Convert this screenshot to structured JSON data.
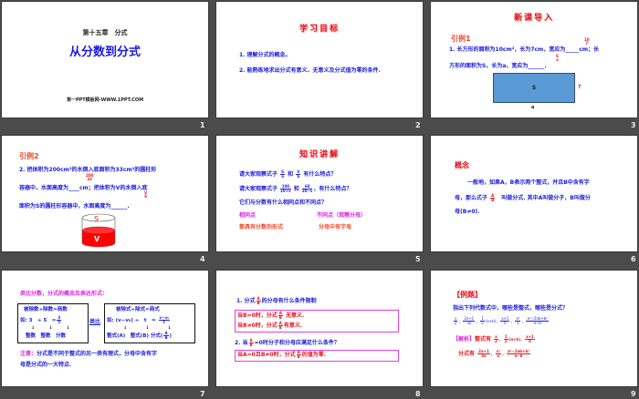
{
  "slides": [
    {
      "number": "1",
      "chapter": "第十五章　分式",
      "title": "从分数到分式",
      "footer": "第一PPT模板网-WWW.1PPT.COM"
    },
    {
      "number": "2",
      "title": "学习目标",
      "items": [
        "1. 理解分式的概念。",
        "2. 能熟练地求出分式有意义、无意义及分式值为零的条件."
      ]
    },
    {
      "number": "3",
      "title": "新课导入",
      "subtitle": "引例1",
      "line1": "1. 长方形的面积为10cm²，长为7cm，宽应为_____cm；长",
      "line2": "方形的面积为S，长为a，宽应为______.",
      "ans1_n": "10",
      "ans1_d": "7",
      "ans2_n": "S",
      "ans2_d": "a",
      "rect_label": "S",
      "side_label": "?",
      "bottom_label": "a",
      "rect_color": "#5b9bd5"
    },
    {
      "number": "4",
      "subtitle": "引例2",
      "line1": "2. 把体积为200cm³的水倒入底面积为33cm²的圆柱形",
      "line2": "容器中，水面高度为____cm；把体积为V的水倒入底",
      "line3": "面积为S的圆柱形容器中，水面高度为______.",
      "ans1_n": "200",
      "ans1_d": "33",
      "ans2_n": "V",
      "ans2_d": "S",
      "top_label": "S",
      "bottom_label": "V",
      "cylinder_color": "#ff0000"
    },
    {
      "number": "5",
      "title": "知识讲解",
      "q1a": "请大家观察式子",
      "q1_f1n": "S",
      "q1_f1d": "a",
      "q1_and": "和",
      "q1_f2n": "V",
      "q1_f2d": "S",
      "q1b": "有什么特点？",
      "q2a": "请大家观察式子",
      "q2_f1n": "100",
      "q2_f1d": "20+v",
      "q2_and": "和",
      "q2_f2n": "60",
      "q2_f2d": "20−v",
      "q2b": "，有什么特点？",
      "q3": "它们与分数有什么相同点和不同点？",
      "same_label": "相同点",
      "diff_label": "不同点（观察分母）",
      "same_text": "都具有分数的形式",
      "diff_text": "分母中有字母"
    },
    {
      "number": "6",
      "subtitle": "概念",
      "line1": "一般地，如果A，B表示两个整式，并且B中含有字",
      "line2a": "母，那么式子",
      "frac_n": "A",
      "frac_d": "B",
      "line2b": "叫做分式. 其中A叫做分子，B叫做分",
      "line3": "母(B≠0)."
    },
    {
      "number": "7",
      "heading": "类比分数，分式的概念及表达形式：",
      "left": {
        "row1": "被除数÷除数=商数",
        "row2": "如: 3　÷ 5　=",
        "frac_n": "3",
        "frac_d": "5",
        "row3": "整数　整数　分数"
      },
      "compare": "类比",
      "right": {
        "row1": "被除式÷除式=商式",
        "row2": "如: (v−v₀) ÷　t　=",
        "frac_n": "v−v₀",
        "frac_d": "t",
        "row3a": "整式(A)　整式(B) 分式(",
        "r_frac_n": "A",
        "r_frac_d": "B",
        "row3b": ")"
      },
      "note_label": "注意：",
      "note1": "分式是不同于整式的另一类有理式，分母中含有字",
      "note2": "母是分式的一大特点."
    },
    {
      "number": "8",
      "q1a": "1. 分式",
      "q1b": "的分母有什么条件限制",
      "b1a": "当B=0时，分式",
      "b1b": "无意义.",
      "b2a": "当B≠0时，分式",
      "b2b": "有意义.",
      "q2a": "2. 当",
      "q2b": "=0时分子和分母应满足什么条件？",
      "b3a": "当A=0且B≠0时，分式",
      "b3b": "的值为零.",
      "fn": "A",
      "fd": "B"
    },
    {
      "number": "9",
      "title": "【例题】",
      "question": "指出下列代数式中，哪些是整式，哪些是分式？",
      "exprs": [
        [
          "x",
          "2"
        ],
        [
          "2x+1",
          "3x"
        ],
        [
          "1",
          "2"
        ],
        [
          "(a+b)，",
          ""
        ],
        [
          "x+1",
          "π"
        ],
        [
          "x²",
          "x"
        ],
        [
          "a²−2ab+b²",
          "a−b"
        ]
      ],
      "analysis_label": "【解析】",
      "int_label": "整式有",
      "int_exprs": [
        [
          "x",
          "2"
        ],
        [
          "1",
          "2"
        ],
        [
          "(a+b)，",
          ""
        ],
        [
          "x+1",
          "π"
        ]
      ],
      "frac_label": "分式有",
      "frac_exprs": [
        [
          "2x+1",
          "3x"
        ],
        [
          "x²",
          "x"
        ],
        [
          "a²−2ab+b²",
          "a−b"
        ]
      ]
    }
  ]
}
